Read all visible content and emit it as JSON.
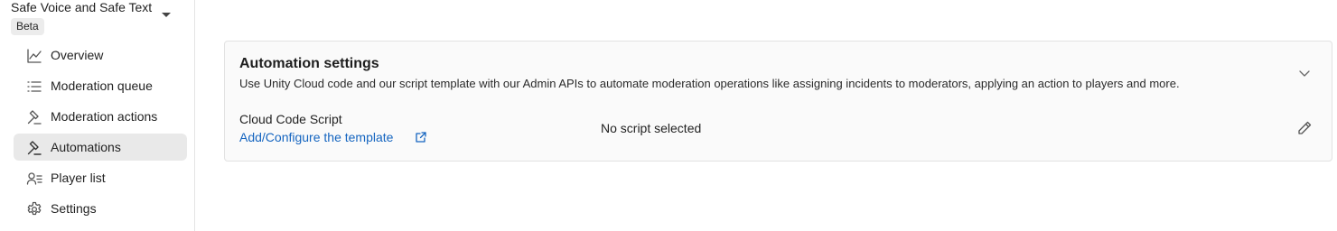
{
  "sidebar": {
    "product_name": "Safe Voice and Safe Text",
    "badge": "Beta",
    "items": [
      {
        "label": "Overview",
        "icon": "chart-line-icon",
        "active": false
      },
      {
        "label": "Moderation queue",
        "icon": "list-icon",
        "active": false
      },
      {
        "label": "Moderation actions",
        "icon": "gavel-icon",
        "active": false
      },
      {
        "label": "Automations",
        "icon": "gavel-icon",
        "active": true
      },
      {
        "label": "Player list",
        "icon": "user-list-icon",
        "active": false
      },
      {
        "label": "Settings",
        "icon": "gear-icon",
        "active": false
      }
    ]
  },
  "automation": {
    "title": "Automation settings",
    "description": "Use Unity Cloud code and our script template with our Admin APIs to automate moderation operations like assigning incidents to moderators, applying an action to players and more.",
    "script_label": "Cloud Code Script",
    "template_link": "Add/Configure the template",
    "script_value": "No script selected"
  },
  "colors": {
    "link": "#1565c0",
    "active_nav_bg": "#e9e9e9",
    "card_bg": "#fafafa"
  }
}
